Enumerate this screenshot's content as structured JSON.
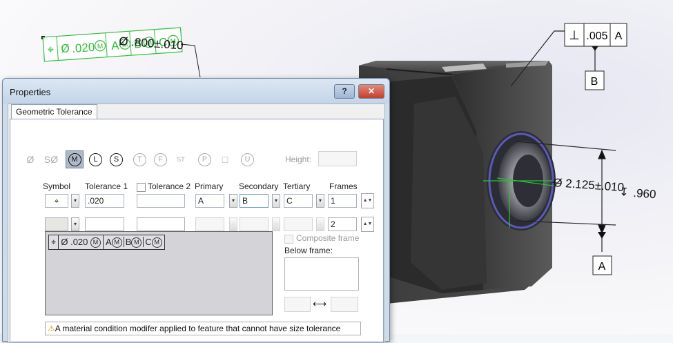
{
  "dialog": {
    "title": "Properties",
    "help_label": "?",
    "close_label": "✕",
    "tab_label": "Geometric Tolerance",
    "symbols": [
      "Ø",
      "SØ",
      "M",
      "L",
      "S",
      "T",
      "F",
      "ST",
      "P",
      "□",
      "U"
    ],
    "height_label": "Height:",
    "headers": {
      "symbol": "Symbol",
      "tolerance1": "Tolerance 1",
      "tolerance2": "Tolerance 2",
      "primary": "Primary",
      "secondary": "Secondary",
      "tertiary": "Tertiary",
      "frames": "Frames"
    },
    "row1": {
      "symbol": "⌖",
      "tolerance1": ".020",
      "tolerance2": "",
      "primary": "A",
      "secondary": "B",
      "tertiary": "C",
      "frame": "1"
    },
    "row2": {
      "frame": "2"
    },
    "preview": {
      "symbol": "⌖",
      "diameter": "Ø",
      "value": ".020",
      "modifier": "M",
      "datums": [
        "A",
        "B",
        "C"
      ]
    },
    "composite_label": "Composite frame",
    "below_label": "Below frame:",
    "swap_label": "⟷",
    "warning_icon": "⚠",
    "warning": "A material condition modifer applied to feature  that cannot have size tolerance"
  },
  "annotations": {
    "green_fcf": {
      "symbol": "⌖",
      "diameter": "Ø",
      "value": ".020",
      "modifier": "M",
      "datums": [
        "A",
        "B",
        "C"
      ]
    },
    "green_dim": "Ø .800±.010",
    "perp_symbol": "⊥",
    "perp_value": ".005",
    "perp_datum": "A",
    "datum_b": "B",
    "datum_a": "A",
    "hole_dim": "Ø 2.125±.010",
    "depth_symbol": "↧",
    "depth_value": ".960"
  },
  "colors": {
    "green": "#2fbf3c",
    "part_dark": "#3a3a3a",
    "dialog_frame": "#cfdbe9"
  }
}
